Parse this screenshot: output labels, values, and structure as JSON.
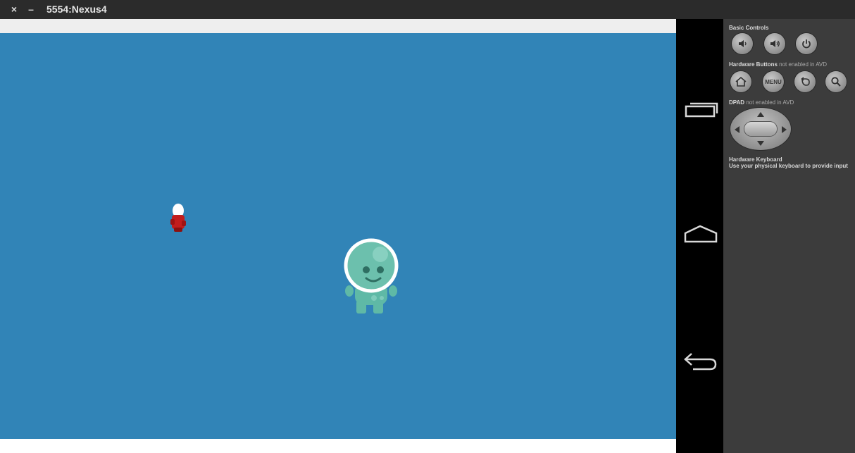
{
  "window": {
    "title": "5554:Nexus4",
    "close_label": "×",
    "minimize_label": "–"
  },
  "game": {
    "background_color": "#3184b7",
    "sprites": [
      "red-character",
      "green-alien-astronaut"
    ]
  },
  "navbar": {
    "buttons": [
      "recent-apps-icon",
      "home-icon",
      "back-icon"
    ]
  },
  "panel": {
    "basic_controls": "Basic Controls",
    "hardware_buttons": "Hardware Buttons",
    "hardware_buttons_note": "not enabled in AVD",
    "menu_label": "MENU",
    "dpad": "DPAD",
    "dpad_note": "not enabled in AVD",
    "keyboard_title": "Hardware Keyboard",
    "keyboard_note": "Use your physical keyboard to provide input"
  }
}
